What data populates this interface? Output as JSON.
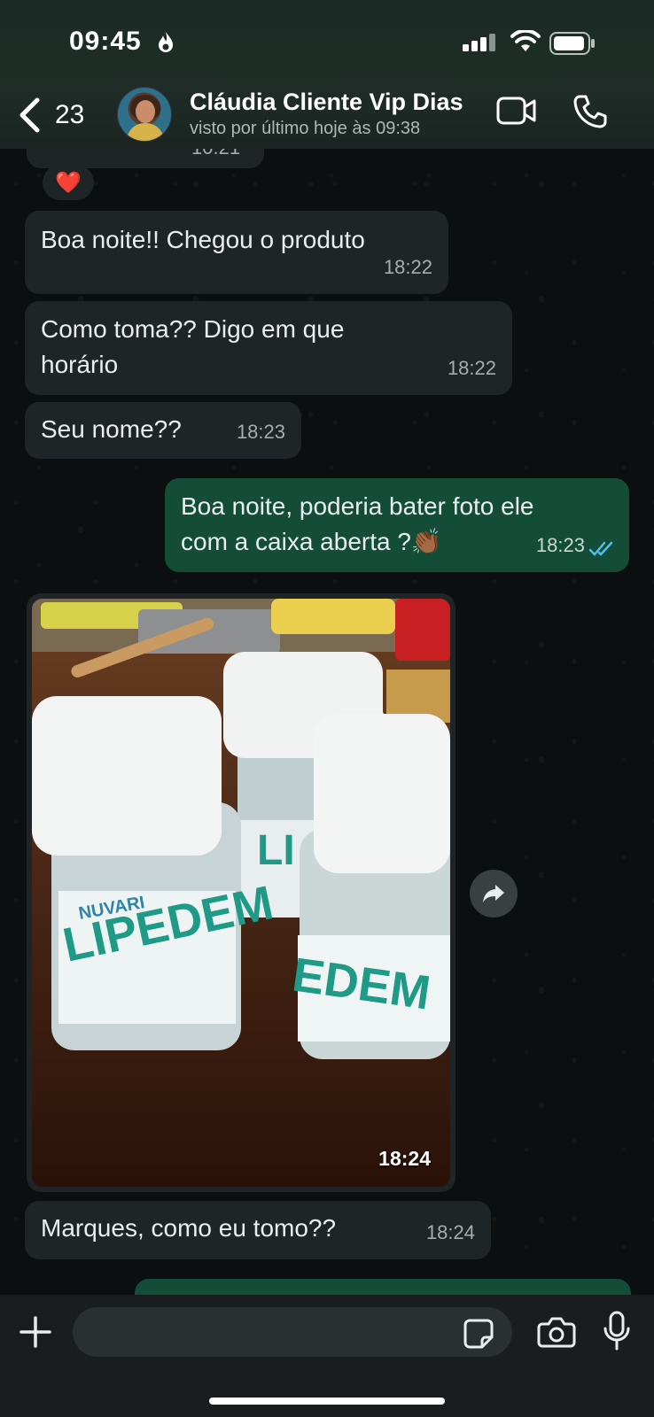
{
  "status_bar": {
    "time": "09:45"
  },
  "header": {
    "back_count": "23",
    "contact_name": "Cláudia Cliente Vip Dias",
    "contact_status": "visto por último hoje às 09:38"
  },
  "previous_message": {
    "time": "10:21"
  },
  "reaction": "❤️",
  "messages": [
    {
      "direction": "in",
      "text": "Boa noite!! Chegou o produto",
      "time": "18:22"
    },
    {
      "direction": "in",
      "text_line1": "Como toma?? Digo  em que",
      "text_line2": "horário",
      "time": "18:22"
    },
    {
      "direction": "in",
      "text": "Seu nome??",
      "time": "18:23"
    },
    {
      "direction": "out",
      "text_line1": "Boa noite, poderia bater foto ele",
      "text_line2": "com a caixa aberta ?👏🏾",
      "time": "18:23",
      "read": true
    },
    {
      "direction": "in",
      "type": "image",
      "time": "18:24",
      "photo_labels": [
        "LIPEDEM",
        "LI",
        "EDEM",
        "NUVARI"
      ]
    },
    {
      "direction": "in",
      "text": "Marques, como eu tomo??",
      "time": "18:24"
    }
  ],
  "composer": {
    "placeholder": ""
  },
  "colors": {
    "incoming_bubble": "#1f2426",
    "outgoing_bubble": "#144d37",
    "header_bg": "#1f2c27",
    "read_tick": "#53bdeb"
  },
  "icons": [
    "back-chevron-icon",
    "video-call-icon",
    "phone-icon",
    "forward-icon",
    "plus-icon",
    "sticker-icon",
    "camera-icon",
    "microphone-icon",
    "double-check-icon"
  ]
}
